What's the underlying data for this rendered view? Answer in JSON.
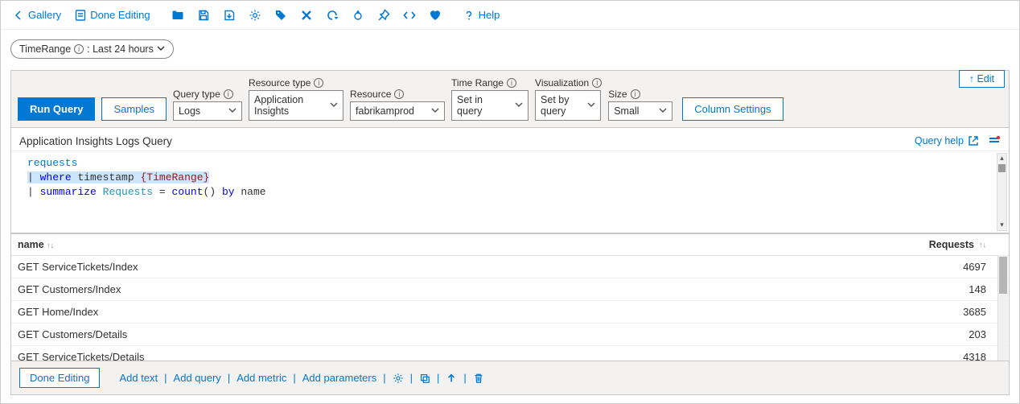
{
  "toolbar": {
    "gallery": "Gallery",
    "done_editing": "Done Editing",
    "help": "Help"
  },
  "time_range_pill": {
    "label": "TimeRange",
    "value": ": Last 24 hours"
  },
  "edit_button": "↑ Edit",
  "config": {
    "run_query": "Run Query",
    "samples": "Samples",
    "fields": {
      "query_type": {
        "label": "Query type",
        "value": "Logs"
      },
      "resource_type": {
        "label": "Resource type",
        "value": "Application Insights"
      },
      "resource": {
        "label": "Resource",
        "value": "fabrikamprod"
      },
      "time_range": {
        "label": "Time Range",
        "value": "Set in query"
      },
      "visualization": {
        "label": "Visualization",
        "value": "Set by query"
      },
      "size": {
        "label": "Size",
        "value": "Small"
      }
    },
    "column_settings": "Column Settings"
  },
  "query": {
    "title": "Application Insights Logs Query",
    "help_link": "Query help",
    "line1_table": "requests",
    "line2_pipe": "|",
    "line2_where": "where",
    "line2_col": "timestamp",
    "line2_param": "{TimeRange}",
    "line3_pipe": "|",
    "line3_summarize": "summarize",
    "line3_alias": "Requests",
    "line3_eq": "=",
    "line3_func": "count",
    "line3_paren": "()",
    "line3_by": "by",
    "line3_col": "name"
  },
  "results": {
    "headers": {
      "name": "name",
      "requests": "Requests"
    },
    "rows": [
      {
        "name": "GET ServiceTickets/Index",
        "requests": "4697"
      },
      {
        "name": "GET Customers/Index",
        "requests": "148"
      },
      {
        "name": "GET Home/Index",
        "requests": "3685"
      },
      {
        "name": "GET Customers/Details",
        "requests": "203"
      },
      {
        "name": "GET ServiceTickets/Details",
        "requests": "4318"
      }
    ]
  },
  "footer": {
    "done_editing": "Done Editing",
    "add_text": "Add text",
    "add_query": "Add query",
    "add_metric": "Add metric",
    "add_parameters": "Add parameters"
  }
}
